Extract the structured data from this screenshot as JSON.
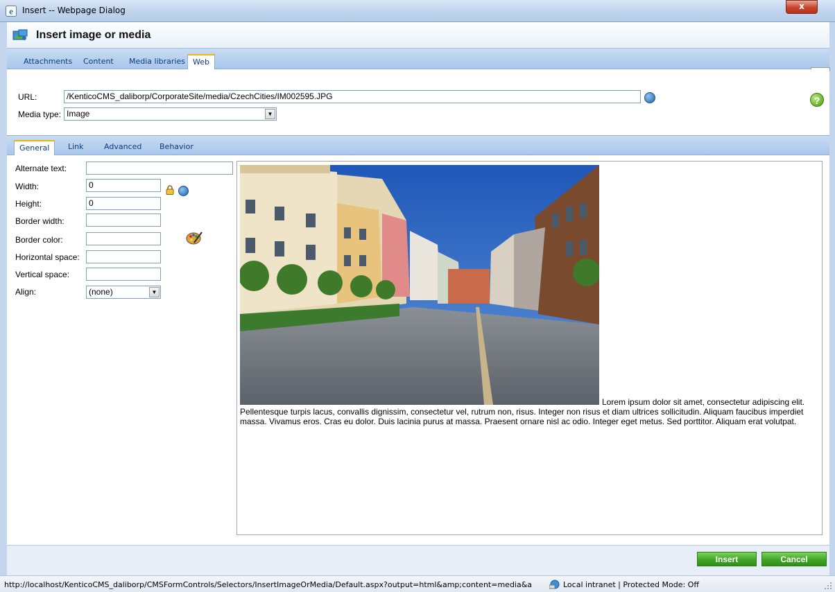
{
  "window": {
    "title": "Insert -- Webpage Dialog",
    "close_label": "x"
  },
  "header": {
    "title": "Insert image or media"
  },
  "top_tabs": [
    {
      "label": "Attachments",
      "active": false
    },
    {
      "label": "Content",
      "active": false
    },
    {
      "label": "Media libraries",
      "active": false
    },
    {
      "label": "Web",
      "active": true
    }
  ],
  "url_panel": {
    "url_label": "URL:",
    "url_value": "/KenticoCMS_daliborp/CorporateSite/media/CzechCities/IM002595.JPG",
    "media_type_label": "Media type:",
    "media_type_value": "Image",
    "help_glyph": "?"
  },
  "mid_tabs": [
    {
      "label": "General",
      "active": true
    },
    {
      "label": "Link",
      "active": false
    },
    {
      "label": "Advanced",
      "active": false
    },
    {
      "label": "Behavior",
      "active": false
    }
  ],
  "general": {
    "alt_label": "Alternate text:",
    "alt_value": "",
    "width_label": "Width:",
    "width_value": "0",
    "height_label": "Height:",
    "height_value": "0",
    "border_width_label": "Border width:",
    "border_width_value": "",
    "border_color_label": "Border color:",
    "border_color_value": "",
    "hspace_label": "Horizontal space:",
    "hspace_value": "",
    "vspace_label": "Vertical space:",
    "vspace_value": "",
    "align_label": "Align:",
    "align_value": "(none)"
  },
  "preview": {
    "text": "Lorem ipsum dolor sit amet, consectetur adipiscing elit. Pellentesque turpis lacus, convallis dignissim, consectetur vel, rutrum non, risus. Integer non risus et diam ultrices sollicitudin. Aliquam faucibus imperdiet massa. Vivamus eros. Cras eu dolor. Duis lacinia purus at massa. Praesent ornare nisl ac odio. Integer eget metus. Sed porttitor. Aliquam erat volutpat."
  },
  "footer": {
    "insert_label": "Insert",
    "cancel_label": "Cancel"
  },
  "statusbar": {
    "url": "http://localhost/KenticoCMS_daliborp/CMSFormControls/Selectors/InsertImageOrMedia/Default.aspx?output=html&amp;content=media&a",
    "zone": "Local intranet | Protected Mode: Off"
  },
  "colors": {
    "accent_tab": "#f5b400",
    "button_green": "#3fa526",
    "tab_text": "#0a3b7c"
  }
}
